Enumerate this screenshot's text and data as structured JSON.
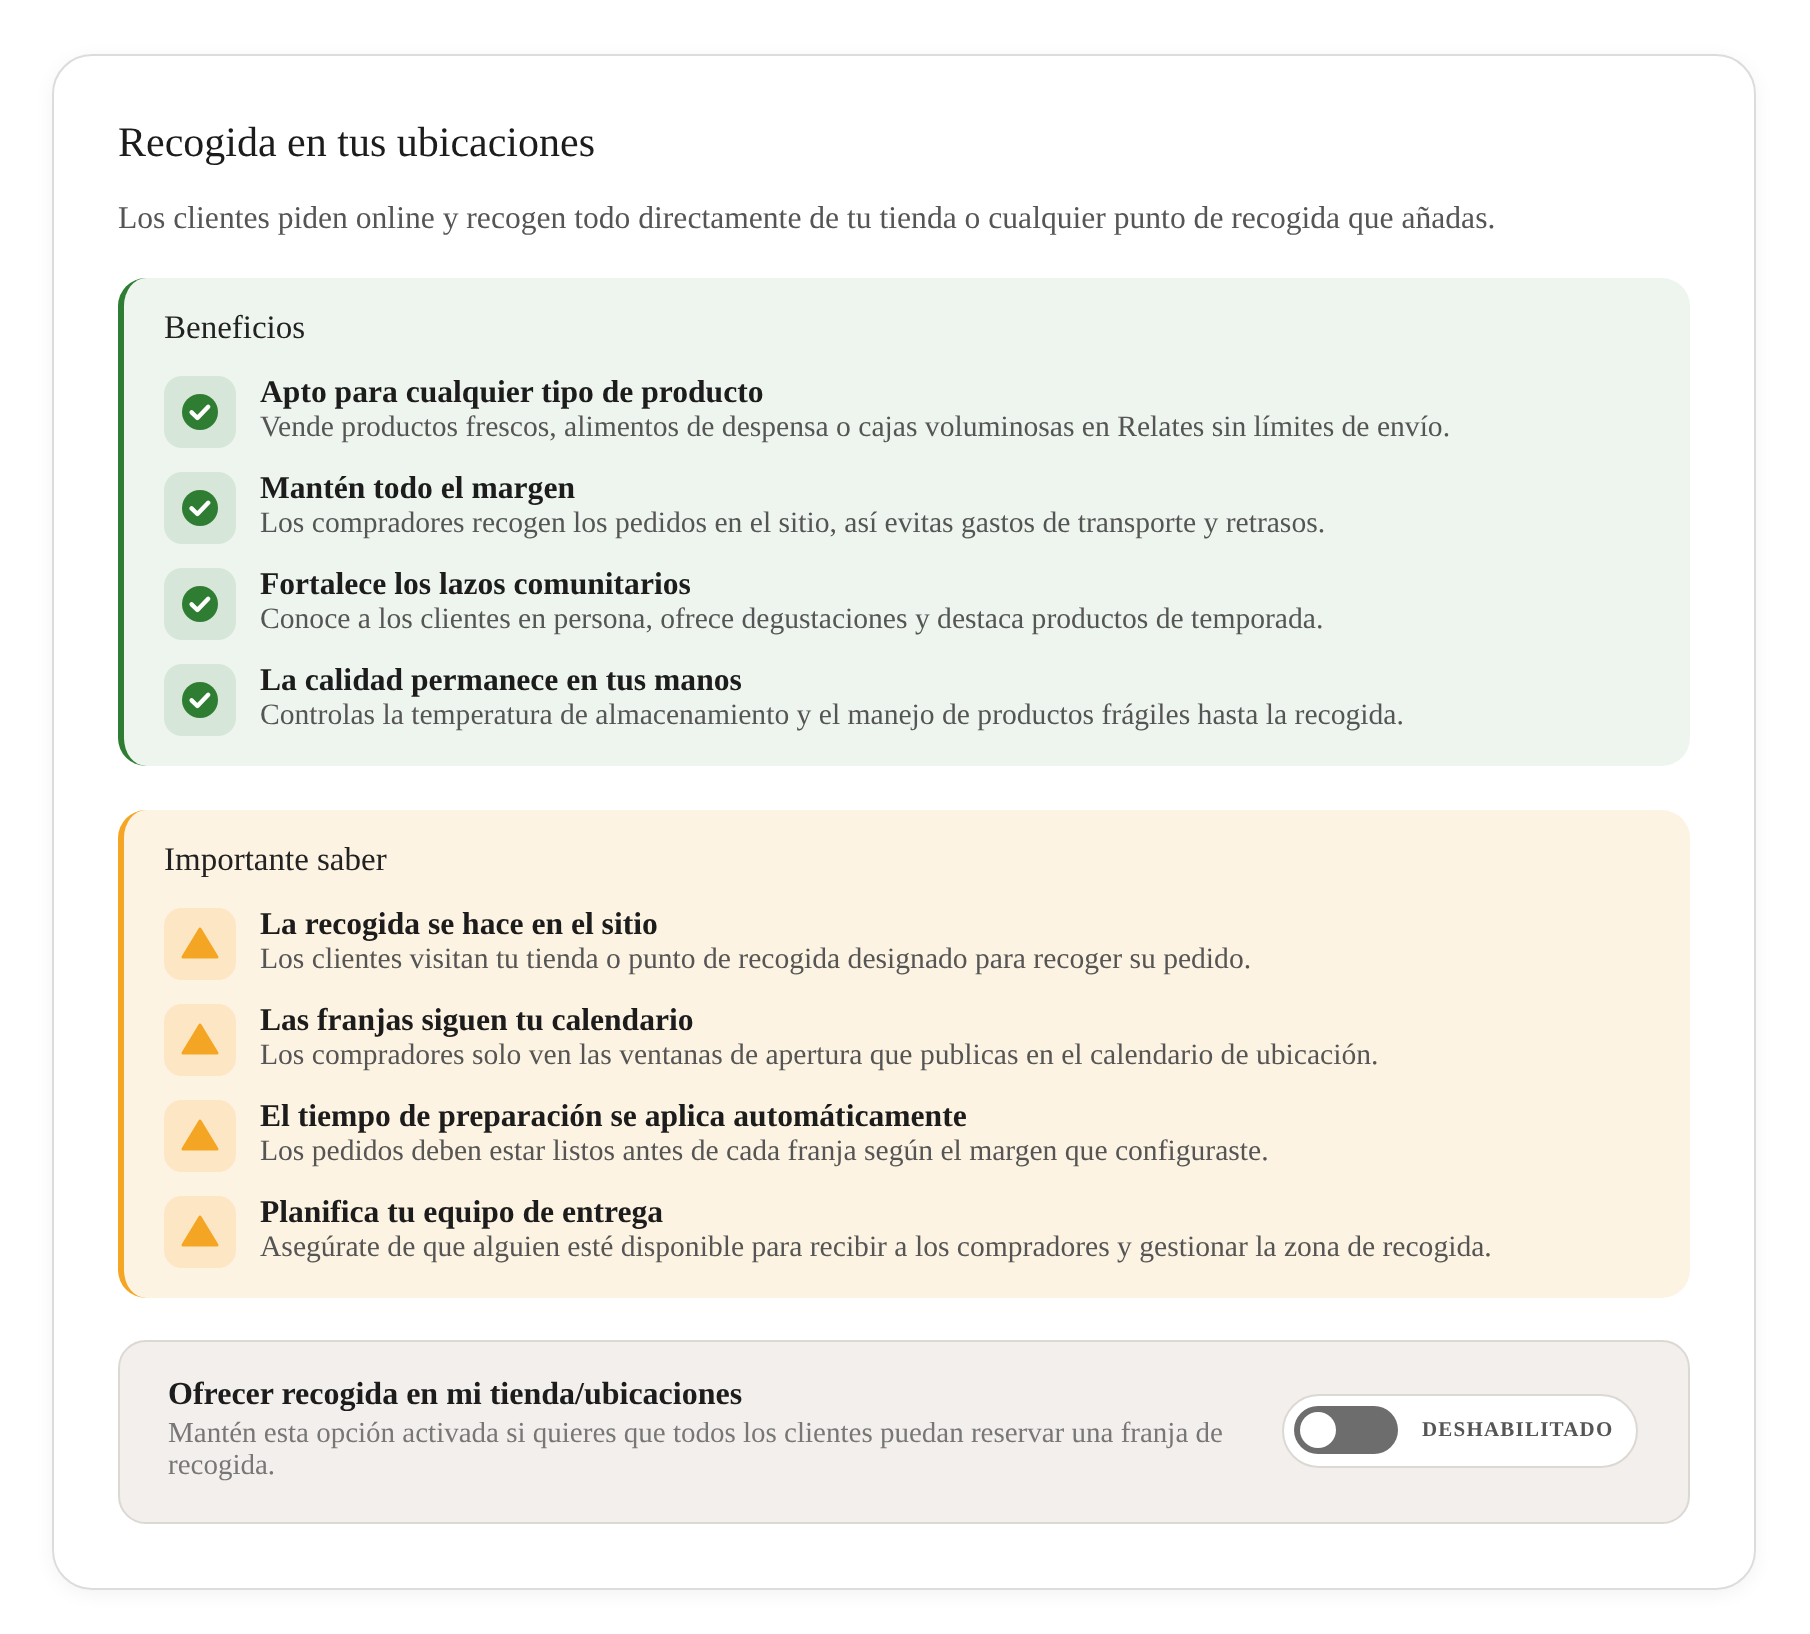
{
  "title": "Recogida en tus ubicaciones",
  "description": "Los clientes piden online y recogen todo directamente de tu tienda o cualquier punto de recogida que añadas.",
  "panels": [
    {
      "kind": "benefits",
      "heading": "Beneficios",
      "items": [
        {
          "title": "Apto para cualquier tipo de producto",
          "text": "Vende productos frescos, alimentos de despensa o cajas voluminosas en Relates sin límites de envío."
        },
        {
          "title": "Mantén todo el margen",
          "text": "Los compradores recogen los pedidos en el sitio, así evitas gastos de transporte y retrasos."
        },
        {
          "title": "Fortalece los lazos comunitarios",
          "text": "Conoce a los clientes en persona, ofrece degustaciones y destaca productos de temporada."
        },
        {
          "title": "La calidad permanece en tus manos",
          "text": "Controlas la temperatura de almacenamiento y el manejo de productos frágiles hasta la recogida."
        }
      ]
    },
    {
      "kind": "warning",
      "heading": "Importante saber",
      "items": [
        {
          "title": "La recogida se hace en el sitio",
          "text": "Los clientes visitan tu tienda o punto de recogida designado para recoger su pedido."
        },
        {
          "title": "Las franjas siguen tu calendario",
          "text": "Los compradores solo ven las ventanas de apertura que publicas en el calendario de ubicación."
        },
        {
          "title": "El tiempo de preparación se aplica automáticamente",
          "text": "Los pedidos deben estar listos antes de cada franja según el margen que configuraste."
        },
        {
          "title": "Planifica tu equipo de entrega",
          "text": "Asegúrate de que alguien esté disponible para recibir a los compradores y gestionar la zona de recogida."
        }
      ]
    }
  ],
  "setting": {
    "title": "Ofrecer recogida en mi tienda/ubicaciones",
    "description": "Mantén esta opción activada si quieres que todos los clientes puedan reservar una franja de recogida.",
    "toggle": {
      "on": false,
      "label": "DESHABILITADO"
    }
  }
}
